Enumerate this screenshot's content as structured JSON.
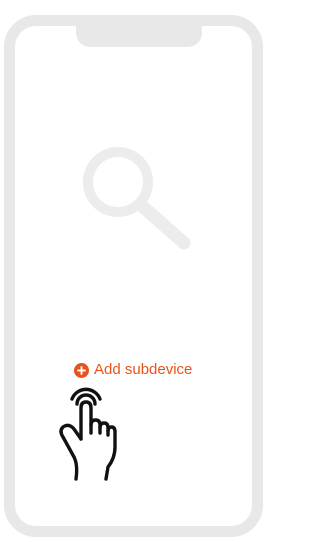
{
  "empty_state": {
    "illustration_icon": "search-icon",
    "illustration_color": "#ececec"
  },
  "actions": {
    "add_subdevice_label": "Add subdevice",
    "add_icon": "plus-circle-icon",
    "accent_color": "#e8531b"
  },
  "gesture_hint": {
    "icon": "tap-hand-icon"
  },
  "frame": {
    "color": "#e8e8e8"
  }
}
